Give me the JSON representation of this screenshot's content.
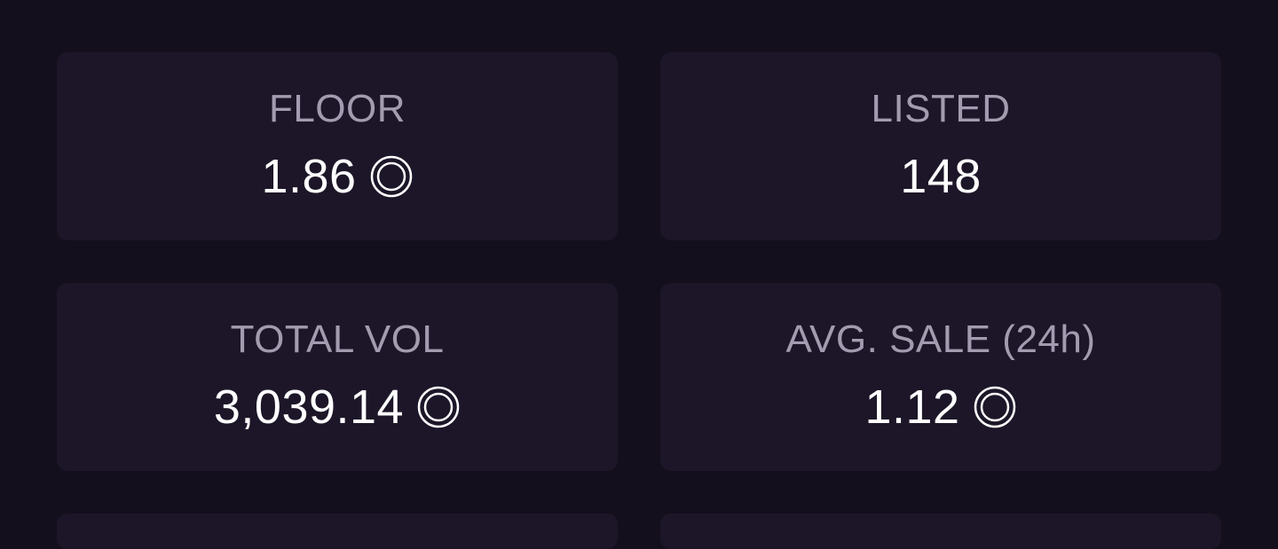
{
  "stats": [
    {
      "label": "FLOOR",
      "value": "1.86",
      "icon": "currency-coin-icon"
    },
    {
      "label": "LISTED",
      "value": "148",
      "icon": null
    },
    {
      "label": "TOTAL VOL",
      "value": "3,039.14",
      "icon": "currency-coin-icon"
    },
    {
      "label": "AVG. SALE (24h)",
      "value": "1.12",
      "icon": "currency-coin-icon"
    }
  ],
  "colors": {
    "background": "#140f1c",
    "card": "#1d1628",
    "label": "#a39bb0",
    "value": "#ffffff"
  }
}
